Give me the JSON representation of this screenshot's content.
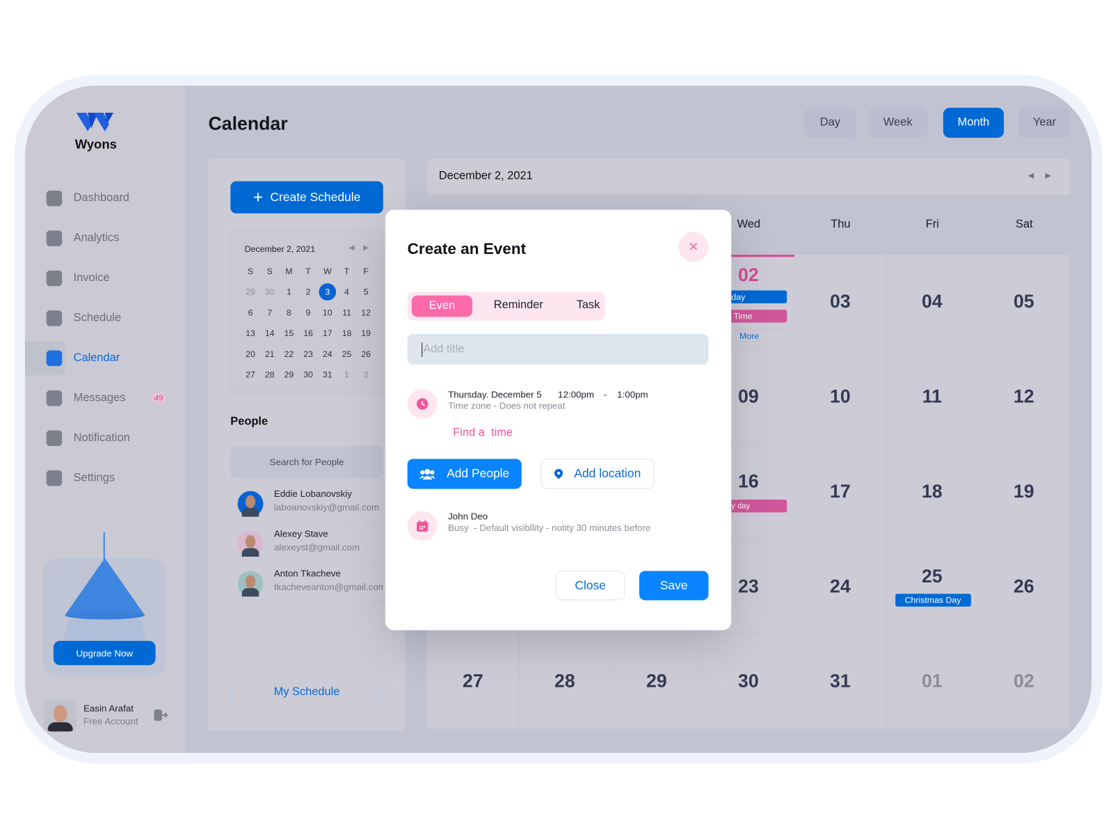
{
  "brand": {
    "name": "Wyons"
  },
  "sidebar": {
    "items": [
      {
        "label": "Dashboard",
        "icon": "grid-icon"
      },
      {
        "label": "Analytics",
        "icon": "chart-icon"
      },
      {
        "label": "Invoice",
        "icon": "ticket-icon"
      },
      {
        "label": "Schedule",
        "icon": "document-icon"
      },
      {
        "label": "Calendar",
        "icon": "calendar-icon",
        "active": true
      },
      {
        "label": "Messages",
        "icon": "messages-icon",
        "badge": "49"
      },
      {
        "label": "Notification",
        "icon": "bell-icon"
      },
      {
        "label": "Settings",
        "icon": "gear-icon"
      }
    ],
    "upgrade_label": "Upgrade Now",
    "user": {
      "name": "Easin Arafat",
      "plan": "Free Account"
    }
  },
  "header": {
    "title": "Calendar",
    "views": [
      "Day",
      "Week",
      "Month",
      "Year"
    ],
    "active_view": "Month"
  },
  "left_panel": {
    "create_label": "Create Schedule",
    "mini_calendar": {
      "title": "December 2, 2021",
      "weekdays": [
        "S",
        "S",
        "M",
        "T",
        "W",
        "T",
        "F"
      ],
      "weeks": [
        [
          "29",
          "30",
          "1",
          "2",
          "3",
          "4",
          "5"
        ],
        [
          "6",
          "7",
          "8",
          "9",
          "10",
          "11",
          "12"
        ],
        [
          "13",
          "14",
          "15",
          "16",
          "17",
          "18",
          "19"
        ],
        [
          "20",
          "21",
          "22",
          "23",
          "24",
          "25",
          "26"
        ],
        [
          "27",
          "28",
          "29",
          "30",
          "31",
          "1",
          "2"
        ]
      ],
      "selected": "3"
    },
    "people_title": "People",
    "search_placeholder": "Search for People",
    "people": [
      {
        "name": "Eddie Lobanovskiy",
        "email": "laboanovskiy@gmail.com"
      },
      {
        "name": "Alexey Stave",
        "email": "alexeyst@gmail.com"
      },
      {
        "name": "Anton Tkacheve",
        "email": "tkacheveanton@gmail.com"
      }
    ],
    "my_schedule_label": "My Schedule"
  },
  "calendar": {
    "date_label": "December 2, 2021",
    "weekday_headers": [
      "",
      "",
      "",
      "Wed",
      "Thu",
      "Fri",
      "Sat"
    ],
    "weeks": [
      [
        "",
        "",
        "",
        "02",
        "03",
        "04",
        "05"
      ],
      [
        "",
        "",
        "",
        "09",
        "10",
        "11",
        "12"
      ],
      [
        "",
        "",
        "",
        "16",
        "17",
        "18",
        "19"
      ],
      [
        "",
        "",
        "",
        "23",
        "24",
        "25",
        "26"
      ],
      [
        "27",
        "28",
        "29",
        "30",
        "31",
        "01",
        "02"
      ]
    ],
    "events": {
      "free_day": "Free day",
      "party_time": "Party Time",
      "more": "More",
      "victory_day": "Victory day",
      "christmas": "Christmas Day"
    },
    "colors": {
      "accent": "#0069d4",
      "pink": "#d0579a",
      "today": "#d64a93"
    }
  },
  "modal": {
    "title": "Create an Event",
    "tabs": [
      "Even",
      "Reminder",
      "Task"
    ],
    "active_tab": "Even",
    "title_placeholder": "Add title",
    "date": "Thursday. December 5",
    "start": "12:00pm",
    "dash": "-",
    "end": "1:00pm",
    "repeat": "Time zone - Does not repeat",
    "find_time": "Find a  time",
    "add_people": "Add People",
    "add_location": "Add location",
    "owner": "John Deo",
    "owner_detail": "Busy  - Default visibllity - notity 30 minutes before",
    "close_label": "Close",
    "save_label": "Save"
  }
}
